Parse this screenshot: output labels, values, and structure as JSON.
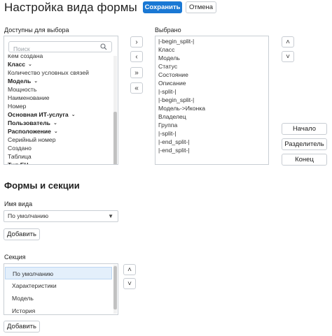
{
  "header": {
    "title": "Настройка вида формы",
    "save_label": "Сохранить",
    "cancel_label": "Отмена"
  },
  "available": {
    "label": "Доступны для выбора",
    "search_placeholder": "Поиск",
    "items": [
      {
        "label": "Кем создана",
        "bold": false,
        "chevron": false
      },
      {
        "label": "Класс",
        "bold": true,
        "chevron": true
      },
      {
        "label": "Количество условных связей",
        "bold": false,
        "chevron": false
      },
      {
        "label": "Модель",
        "bold": true,
        "chevron": true
      },
      {
        "label": "Мощность",
        "bold": false,
        "chevron": false
      },
      {
        "label": "Наименование",
        "bold": false,
        "chevron": false
      },
      {
        "label": "Номер",
        "bold": false,
        "chevron": false
      },
      {
        "label": "Основная ИТ-услуга",
        "bold": true,
        "chevron": true
      },
      {
        "label": "Пользователь",
        "bold": true,
        "chevron": true
      },
      {
        "label": "Расположение",
        "bold": true,
        "chevron": true
      },
      {
        "label": "Серийный номер",
        "bold": false,
        "chevron": false
      },
      {
        "label": "Создано",
        "bold": false,
        "chevron": false
      },
      {
        "label": "Таблица",
        "bold": false,
        "chevron": false
      },
      {
        "label": "Тип ЕЦ",
        "bold": true,
        "chevron": false
      }
    ]
  },
  "selected": {
    "label": "Выбрано",
    "items": [
      "|-begin_split-|",
      "Класс",
      "Модель",
      "Статус",
      "Состояние",
      "Описание",
      "|-split-|",
      "|-begin_split-|",
      "Модель->Иконка",
      "Владелец",
      "Группа",
      "|-split-|",
      "|-end_split-|",
      "|-end_split-|"
    ]
  },
  "transfer": {
    "add_one": "›",
    "remove_one": "‹",
    "add_all": "»",
    "remove_all": "«"
  },
  "order": {
    "up": "˄",
    "down": "˅",
    "start_label": "Начало",
    "divider_label": "Разделитель",
    "end_label": "Конец"
  },
  "forms": {
    "title": "Формы и секции",
    "view_name_label": "Имя вида",
    "view_value": "По умолчанию",
    "add_label": "Добавить",
    "section_label": "Секция",
    "sections": [
      "По умолчанию",
      "Характеристики",
      "Модель",
      "История"
    ],
    "selected_section_index": 0,
    "add_section_label": "Добавить"
  },
  "icons": {
    "search": "search-icon",
    "caret": "chevron-down-icon"
  }
}
